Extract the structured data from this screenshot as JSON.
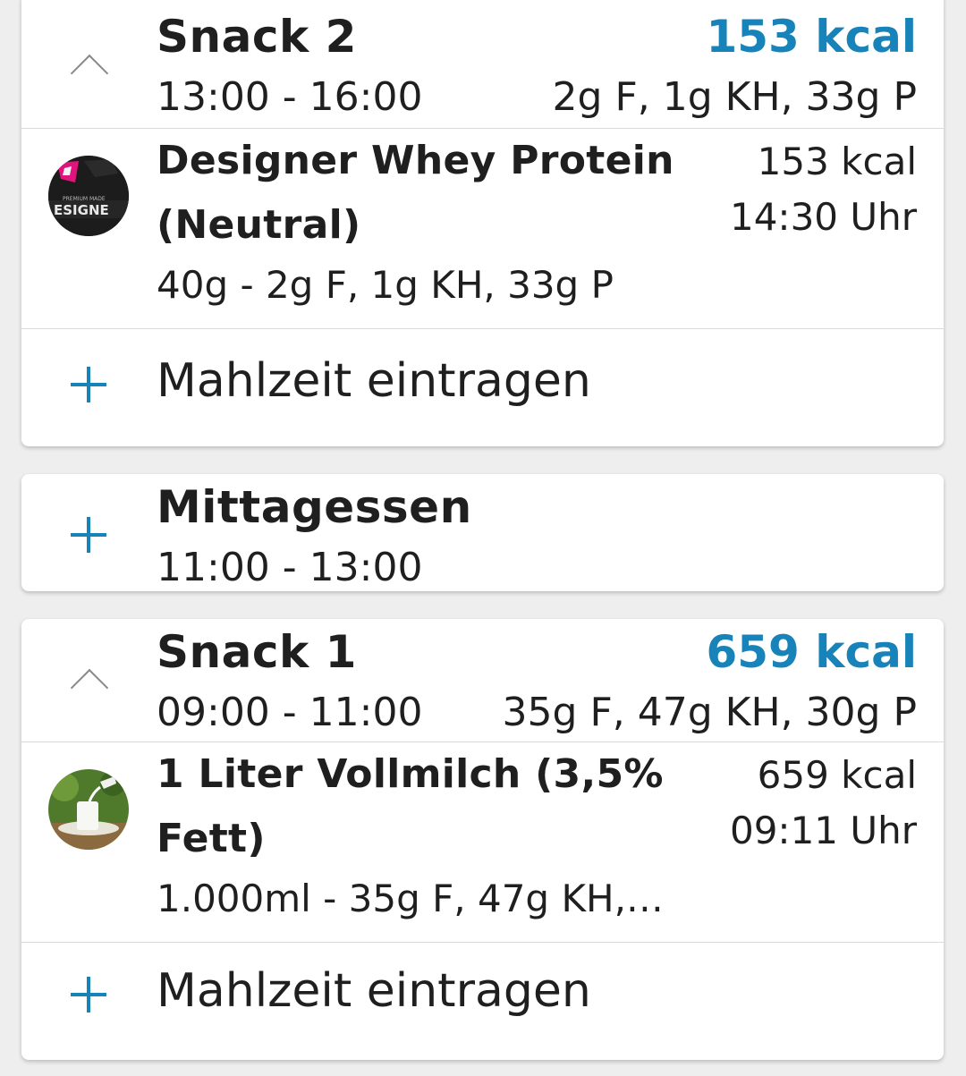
{
  "colors": {
    "accent": "#1783b8"
  },
  "meals": [
    {
      "title": "Snack 2",
      "time": "13:00 - 16:00",
      "kcal": "153 kcal",
      "macros": "2g F, 1g KH, 33g P",
      "toggle_icon": "chevron-up-icon",
      "entries": [
        {
          "name_line1": "Designer Whey Protein",
          "name_line2": "(Neutral)",
          "detail": "40g - 2g F, 1g KH, 33g P",
          "kcal": "153 kcal",
          "time": "14:30 Uhr",
          "image": "protein-powder-thumbnail"
        }
      ],
      "add_label": "Mahlzeit eintragen"
    },
    {
      "title": "Mittagessen",
      "time": "11:00 - 13:00",
      "toggle_icon": "plus-icon"
    },
    {
      "title": "Snack 1",
      "time": "09:00 - 11:00",
      "kcal": "659 kcal",
      "macros": "35g F, 47g KH, 30g P",
      "toggle_icon": "chevron-up-icon",
      "entries": [
        {
          "name_line1": "1 Liter Vollmilch (3,5%",
          "name_line2": "Fett)",
          "detail": "1.000ml - 35g F, 47g KH,…",
          "kcal": "659 kcal",
          "time": "09:11 Uhr",
          "image": "milk-glass-thumbnail"
        }
      ],
      "add_label": "Mahlzeit eintragen"
    }
  ]
}
